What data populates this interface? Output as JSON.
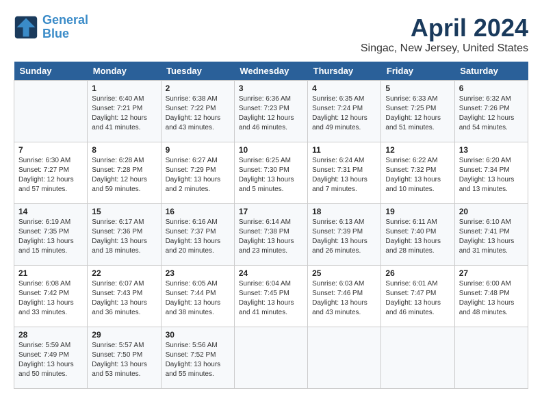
{
  "logo": {
    "line1": "General",
    "line2": "Blue"
  },
  "title": "April 2024",
  "subtitle": "Singac, New Jersey, United States",
  "days_of_week": [
    "Sunday",
    "Monday",
    "Tuesday",
    "Wednesday",
    "Thursday",
    "Friday",
    "Saturday"
  ],
  "weeks": [
    [
      {
        "day": "",
        "info": ""
      },
      {
        "day": "1",
        "info": "Sunrise: 6:40 AM\nSunset: 7:21 PM\nDaylight: 12 hours\nand 41 minutes."
      },
      {
        "day": "2",
        "info": "Sunrise: 6:38 AM\nSunset: 7:22 PM\nDaylight: 12 hours\nand 43 minutes."
      },
      {
        "day": "3",
        "info": "Sunrise: 6:36 AM\nSunset: 7:23 PM\nDaylight: 12 hours\nand 46 minutes."
      },
      {
        "day": "4",
        "info": "Sunrise: 6:35 AM\nSunset: 7:24 PM\nDaylight: 12 hours\nand 49 minutes."
      },
      {
        "day": "5",
        "info": "Sunrise: 6:33 AM\nSunset: 7:25 PM\nDaylight: 12 hours\nand 51 minutes."
      },
      {
        "day": "6",
        "info": "Sunrise: 6:32 AM\nSunset: 7:26 PM\nDaylight: 12 hours\nand 54 minutes."
      }
    ],
    [
      {
        "day": "7",
        "info": "Sunrise: 6:30 AM\nSunset: 7:27 PM\nDaylight: 12 hours\nand 57 minutes."
      },
      {
        "day": "8",
        "info": "Sunrise: 6:28 AM\nSunset: 7:28 PM\nDaylight: 12 hours\nand 59 minutes."
      },
      {
        "day": "9",
        "info": "Sunrise: 6:27 AM\nSunset: 7:29 PM\nDaylight: 13 hours\nand 2 minutes."
      },
      {
        "day": "10",
        "info": "Sunrise: 6:25 AM\nSunset: 7:30 PM\nDaylight: 13 hours\nand 5 minutes."
      },
      {
        "day": "11",
        "info": "Sunrise: 6:24 AM\nSunset: 7:31 PM\nDaylight: 13 hours\nand 7 minutes."
      },
      {
        "day": "12",
        "info": "Sunrise: 6:22 AM\nSunset: 7:32 PM\nDaylight: 13 hours\nand 10 minutes."
      },
      {
        "day": "13",
        "info": "Sunrise: 6:20 AM\nSunset: 7:34 PM\nDaylight: 13 hours\nand 13 minutes."
      }
    ],
    [
      {
        "day": "14",
        "info": "Sunrise: 6:19 AM\nSunset: 7:35 PM\nDaylight: 13 hours\nand 15 minutes."
      },
      {
        "day": "15",
        "info": "Sunrise: 6:17 AM\nSunset: 7:36 PM\nDaylight: 13 hours\nand 18 minutes."
      },
      {
        "day": "16",
        "info": "Sunrise: 6:16 AM\nSunset: 7:37 PM\nDaylight: 13 hours\nand 20 minutes."
      },
      {
        "day": "17",
        "info": "Sunrise: 6:14 AM\nSunset: 7:38 PM\nDaylight: 13 hours\nand 23 minutes."
      },
      {
        "day": "18",
        "info": "Sunrise: 6:13 AM\nSunset: 7:39 PM\nDaylight: 13 hours\nand 26 minutes."
      },
      {
        "day": "19",
        "info": "Sunrise: 6:11 AM\nSunset: 7:40 PM\nDaylight: 13 hours\nand 28 minutes."
      },
      {
        "day": "20",
        "info": "Sunrise: 6:10 AM\nSunset: 7:41 PM\nDaylight: 13 hours\nand 31 minutes."
      }
    ],
    [
      {
        "day": "21",
        "info": "Sunrise: 6:08 AM\nSunset: 7:42 PM\nDaylight: 13 hours\nand 33 minutes."
      },
      {
        "day": "22",
        "info": "Sunrise: 6:07 AM\nSunset: 7:43 PM\nDaylight: 13 hours\nand 36 minutes."
      },
      {
        "day": "23",
        "info": "Sunrise: 6:05 AM\nSunset: 7:44 PM\nDaylight: 13 hours\nand 38 minutes."
      },
      {
        "day": "24",
        "info": "Sunrise: 6:04 AM\nSunset: 7:45 PM\nDaylight: 13 hours\nand 41 minutes."
      },
      {
        "day": "25",
        "info": "Sunrise: 6:03 AM\nSunset: 7:46 PM\nDaylight: 13 hours\nand 43 minutes."
      },
      {
        "day": "26",
        "info": "Sunrise: 6:01 AM\nSunset: 7:47 PM\nDaylight: 13 hours\nand 46 minutes."
      },
      {
        "day": "27",
        "info": "Sunrise: 6:00 AM\nSunset: 7:48 PM\nDaylight: 13 hours\nand 48 minutes."
      }
    ],
    [
      {
        "day": "28",
        "info": "Sunrise: 5:59 AM\nSunset: 7:49 PM\nDaylight: 13 hours\nand 50 minutes."
      },
      {
        "day": "29",
        "info": "Sunrise: 5:57 AM\nSunset: 7:50 PM\nDaylight: 13 hours\nand 53 minutes."
      },
      {
        "day": "30",
        "info": "Sunrise: 5:56 AM\nSunset: 7:52 PM\nDaylight: 13 hours\nand 55 minutes."
      },
      {
        "day": "",
        "info": ""
      },
      {
        "day": "",
        "info": ""
      },
      {
        "day": "",
        "info": ""
      },
      {
        "day": "",
        "info": ""
      }
    ]
  ]
}
